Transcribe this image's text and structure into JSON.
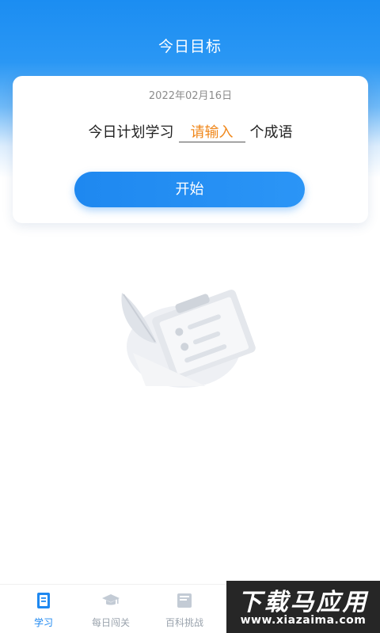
{
  "header": {
    "title": "今日目标"
  },
  "card": {
    "date": "2022年02月16日",
    "plan_prefix": "今日计划学习",
    "input_placeholder": "请输入",
    "plan_suffix": "个成语",
    "start_label": "开始"
  },
  "empty_state": {
    "illustration": "clipboard-quill-illustration"
  },
  "tab_bar": {
    "items": [
      {
        "label": "学习",
        "icon": "book-icon",
        "active": true
      },
      {
        "label": "每日闯关",
        "icon": "graduation-cap-icon",
        "active": false
      },
      {
        "label": "百科挑战",
        "icon": "encyclopedia-icon",
        "active": false
      }
    ]
  },
  "watermark": {
    "title": "下载马应用",
    "url": "www.xiazaima.com"
  },
  "colors": {
    "primary": "#1e88f0",
    "accent": "#f0871a",
    "inactive": "#9aa3ad"
  }
}
